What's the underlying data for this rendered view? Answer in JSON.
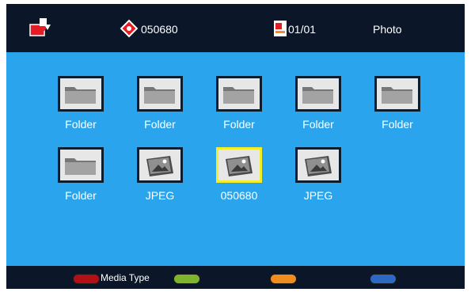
{
  "header": {
    "disk_count": "050680",
    "page_indicator": "01/01",
    "mode": "Photo"
  },
  "items": [
    {
      "label": "Folder",
      "kind": "folder"
    },
    {
      "label": "Folder",
      "kind": "folder"
    },
    {
      "label": "Folder",
      "kind": "folder"
    },
    {
      "label": "Folder",
      "kind": "folder"
    },
    {
      "label": "Folder",
      "kind": "folder"
    },
    {
      "label": "Folder",
      "kind": "folder"
    },
    {
      "label": "JPEG",
      "kind": "image"
    },
    {
      "label": "050680",
      "kind": "image",
      "selected": true
    },
    {
      "label": "JPEG",
      "kind": "image"
    }
  ],
  "footer": {
    "red_label": "Media Type",
    "colors": {
      "red": "#b30f17",
      "green": "#7fb52c",
      "yellow": "#f08d1f",
      "blue": "#2d68c4"
    }
  },
  "icons": [
    "file-manager-icon",
    "disk-icon",
    "page-icon",
    "folder-icon",
    "photo-icon"
  ]
}
